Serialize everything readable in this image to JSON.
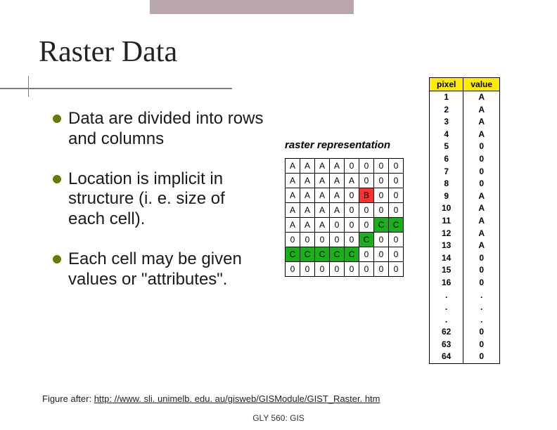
{
  "title": "Raster Data",
  "bullets": [
    "Data are divided into rows and columns",
    "Location is implicit in structure (i. e. size of each cell).",
    "Each cell may be given values or \"attributes\"."
  ],
  "raster_label": "raster representation",
  "grid": [
    [
      "A",
      "A",
      "A",
      "A",
      "0",
      "0",
      "0",
      "0"
    ],
    [
      "A",
      "A",
      "A",
      "A",
      "A",
      "0",
      "0",
      "0"
    ],
    [
      "A",
      "A",
      "A",
      "A",
      "0",
      "B",
      "0",
      "0"
    ],
    [
      "A",
      "A",
      "A",
      "A",
      "0",
      "0",
      "0",
      "0"
    ],
    [
      "A",
      "A",
      "A",
      "0",
      "0",
      "0",
      "C",
      "C"
    ],
    [
      "0",
      "0",
      "0",
      "0",
      "0",
      "C",
      "0",
      "0"
    ],
    [
      "C",
      "C",
      "C",
      "C",
      "C",
      "0",
      "0",
      "0"
    ],
    [
      "0",
      "0",
      "0",
      "0",
      "0",
      "0",
      "0",
      "0"
    ]
  ],
  "table_headers": {
    "pixel": "pixel",
    "value": "value"
  },
  "pixel_values": [
    {
      "pixel": "1",
      "value": "A"
    },
    {
      "pixel": "2",
      "value": "A"
    },
    {
      "pixel": "3",
      "value": "A"
    },
    {
      "pixel": "4",
      "value": "A"
    },
    {
      "pixel": "5",
      "value": "0"
    },
    {
      "pixel": "6",
      "value": "0"
    },
    {
      "pixel": "7",
      "value": "0"
    },
    {
      "pixel": "8",
      "value": "0"
    },
    {
      "pixel": "9",
      "value": "A"
    },
    {
      "pixel": "10",
      "value": "A"
    },
    {
      "pixel": "11",
      "value": "A"
    },
    {
      "pixel": "12",
      "value": "A"
    },
    {
      "pixel": "13",
      "value": "A"
    },
    {
      "pixel": "14",
      "value": "0"
    },
    {
      "pixel": "15",
      "value": "0"
    },
    {
      "pixel": "16",
      "value": "0"
    },
    {
      "pixel": ".",
      "value": "."
    },
    {
      "pixel": ".",
      "value": "."
    },
    {
      "pixel": ".",
      "value": "."
    },
    {
      "pixel": "62",
      "value": "0"
    },
    {
      "pixel": "63",
      "value": "0"
    },
    {
      "pixel": "64",
      "value": "0"
    }
  ],
  "figure_prefix": "Figure after: ",
  "figure_url": "http: //www. sli. unimelb. edu. au/gisweb/GISModule/GIST_Raster. htm",
  "footer": "GLY 560: GIS"
}
